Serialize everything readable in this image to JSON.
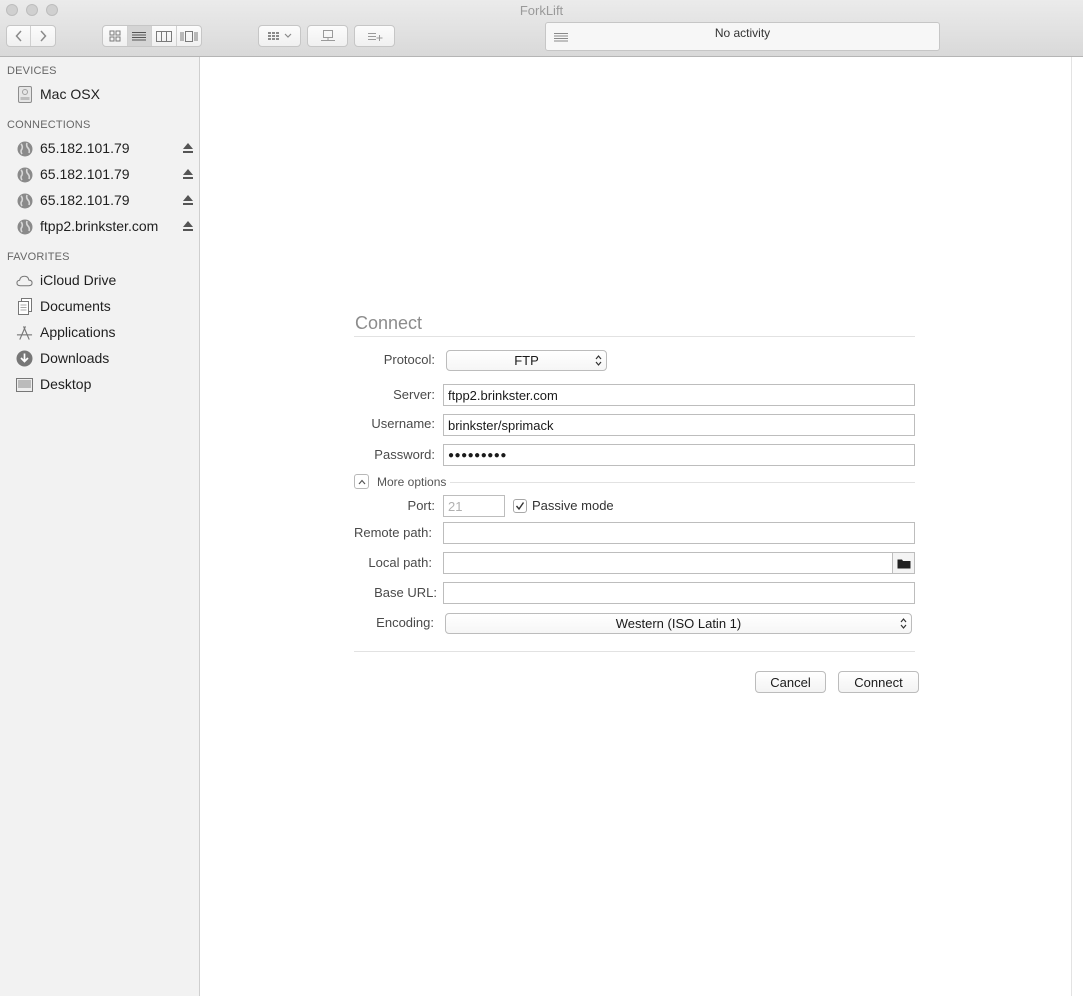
{
  "window": {
    "title": "ForkLift"
  },
  "toolbar": {
    "activity_text": "No activity",
    "icons": [
      "back-icon",
      "forward-icon",
      "icon-view-icon",
      "list-view-icon",
      "column-view-icon",
      "coverflow-view-icon",
      "arrange-icon",
      "connect-to-server-icon",
      "add-bookmark-icon",
      "activity-list-icon"
    ]
  },
  "sidebar": {
    "devices_header": "DEVICES",
    "devices": [
      {
        "label": "Mac OSX",
        "icon": "hard-drive-icon"
      }
    ],
    "connections_header": "CONNECTIONS",
    "connections": [
      {
        "label": "65.182.101.79",
        "icon": "globe-icon"
      },
      {
        "label": "65.182.101.79",
        "icon": "globe-icon"
      },
      {
        "label": "65.182.101.79",
        "icon": "globe-icon"
      },
      {
        "label": "ftpp2.brinkster.com",
        "icon": "globe-icon"
      }
    ],
    "favorites_header": "FAVORITES",
    "favorites": [
      {
        "label": "iCloud Drive",
        "icon": "cloud-icon"
      },
      {
        "label": "Documents",
        "icon": "documents-icon"
      },
      {
        "label": "Applications",
        "icon": "applications-icon"
      },
      {
        "label": "Downloads",
        "icon": "downloads-icon"
      },
      {
        "label": "Desktop",
        "icon": "desktop-icon"
      }
    ]
  },
  "connect_form": {
    "title": "Connect",
    "protocol_label": "Protocol:",
    "protocol_value": "FTP",
    "server_label": "Server:",
    "server_value": "ftpp2.brinkster.com",
    "username_label": "Username:",
    "username_value": "brinkster/sprimack",
    "password_label": "Password:",
    "password_value": "●●●●●●●●●",
    "more_options_label": "More options",
    "port_label": "Port:",
    "port_placeholder": "21",
    "passive_mode_label": "Passive mode",
    "passive_mode_checked": true,
    "remote_path_label": "Remote path:",
    "remote_path_value": "",
    "local_path_label": "Local path:",
    "local_path_value": "",
    "base_url_label": "Base URL:",
    "base_url_value": "",
    "encoding_label": "Encoding:",
    "encoding_value": "Western (ISO Latin 1)",
    "cancel_label": "Cancel",
    "connect_label": "Connect"
  }
}
